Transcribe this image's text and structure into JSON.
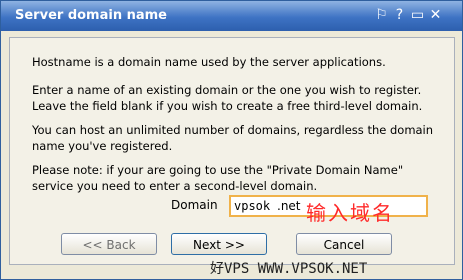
{
  "dialog": {
    "title": "Server domain name",
    "title_icons": [
      "pin-icon",
      "help-icon",
      "restore-icon",
      "close-icon"
    ],
    "title_icon_glyphs": [
      "⚐",
      "?",
      "▭",
      "✕"
    ],
    "paragraphs": [
      "Hostname is a domain name used by the server applications.",
      "Enter a name of an existing domain or the one you wish to register. Leave the field blank if you wish to create a free third-level domain.",
      "You can host an unlimited number of domains, regardless the domain name you've registered.",
      "Please note: if your are going to use the \"Private Domain Name\" service you need to enter a second-level domain."
    ],
    "domain_field": {
      "label": "Domain",
      "value": "vpsok",
      "suffix": ".net"
    },
    "annotation": "输入域名",
    "buttons": {
      "back": "<< Back",
      "next": "Next >>",
      "cancel": "Cancel"
    },
    "watermark": "好VPS WWW.VPSOK.NET",
    "colors": {
      "titlebar": "#3e73c4",
      "annotation": "#ff2a2a",
      "field_border": "#f0b24a"
    }
  }
}
